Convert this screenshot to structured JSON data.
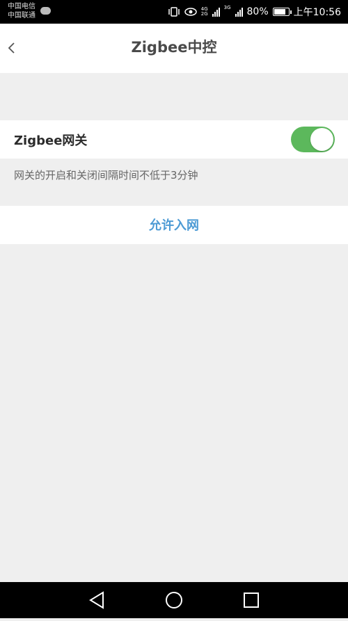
{
  "status_bar": {
    "carrier1": "中国电信",
    "carrier2": "中国联通",
    "net1": "4G",
    "net2": "2G",
    "net3": "3G",
    "battery": "80%",
    "time": "上午10:56"
  },
  "header": {
    "title": "Zigbee中控"
  },
  "gateway": {
    "label": "Zigbee网关",
    "enabled": true
  },
  "hint_text": "网关的开启和关闭间隔时间不低于3分钟",
  "allow_join": {
    "label": "允许入网"
  },
  "colors": {
    "toggle_on": "#5cb85c",
    "link": "#4d9bd5"
  }
}
